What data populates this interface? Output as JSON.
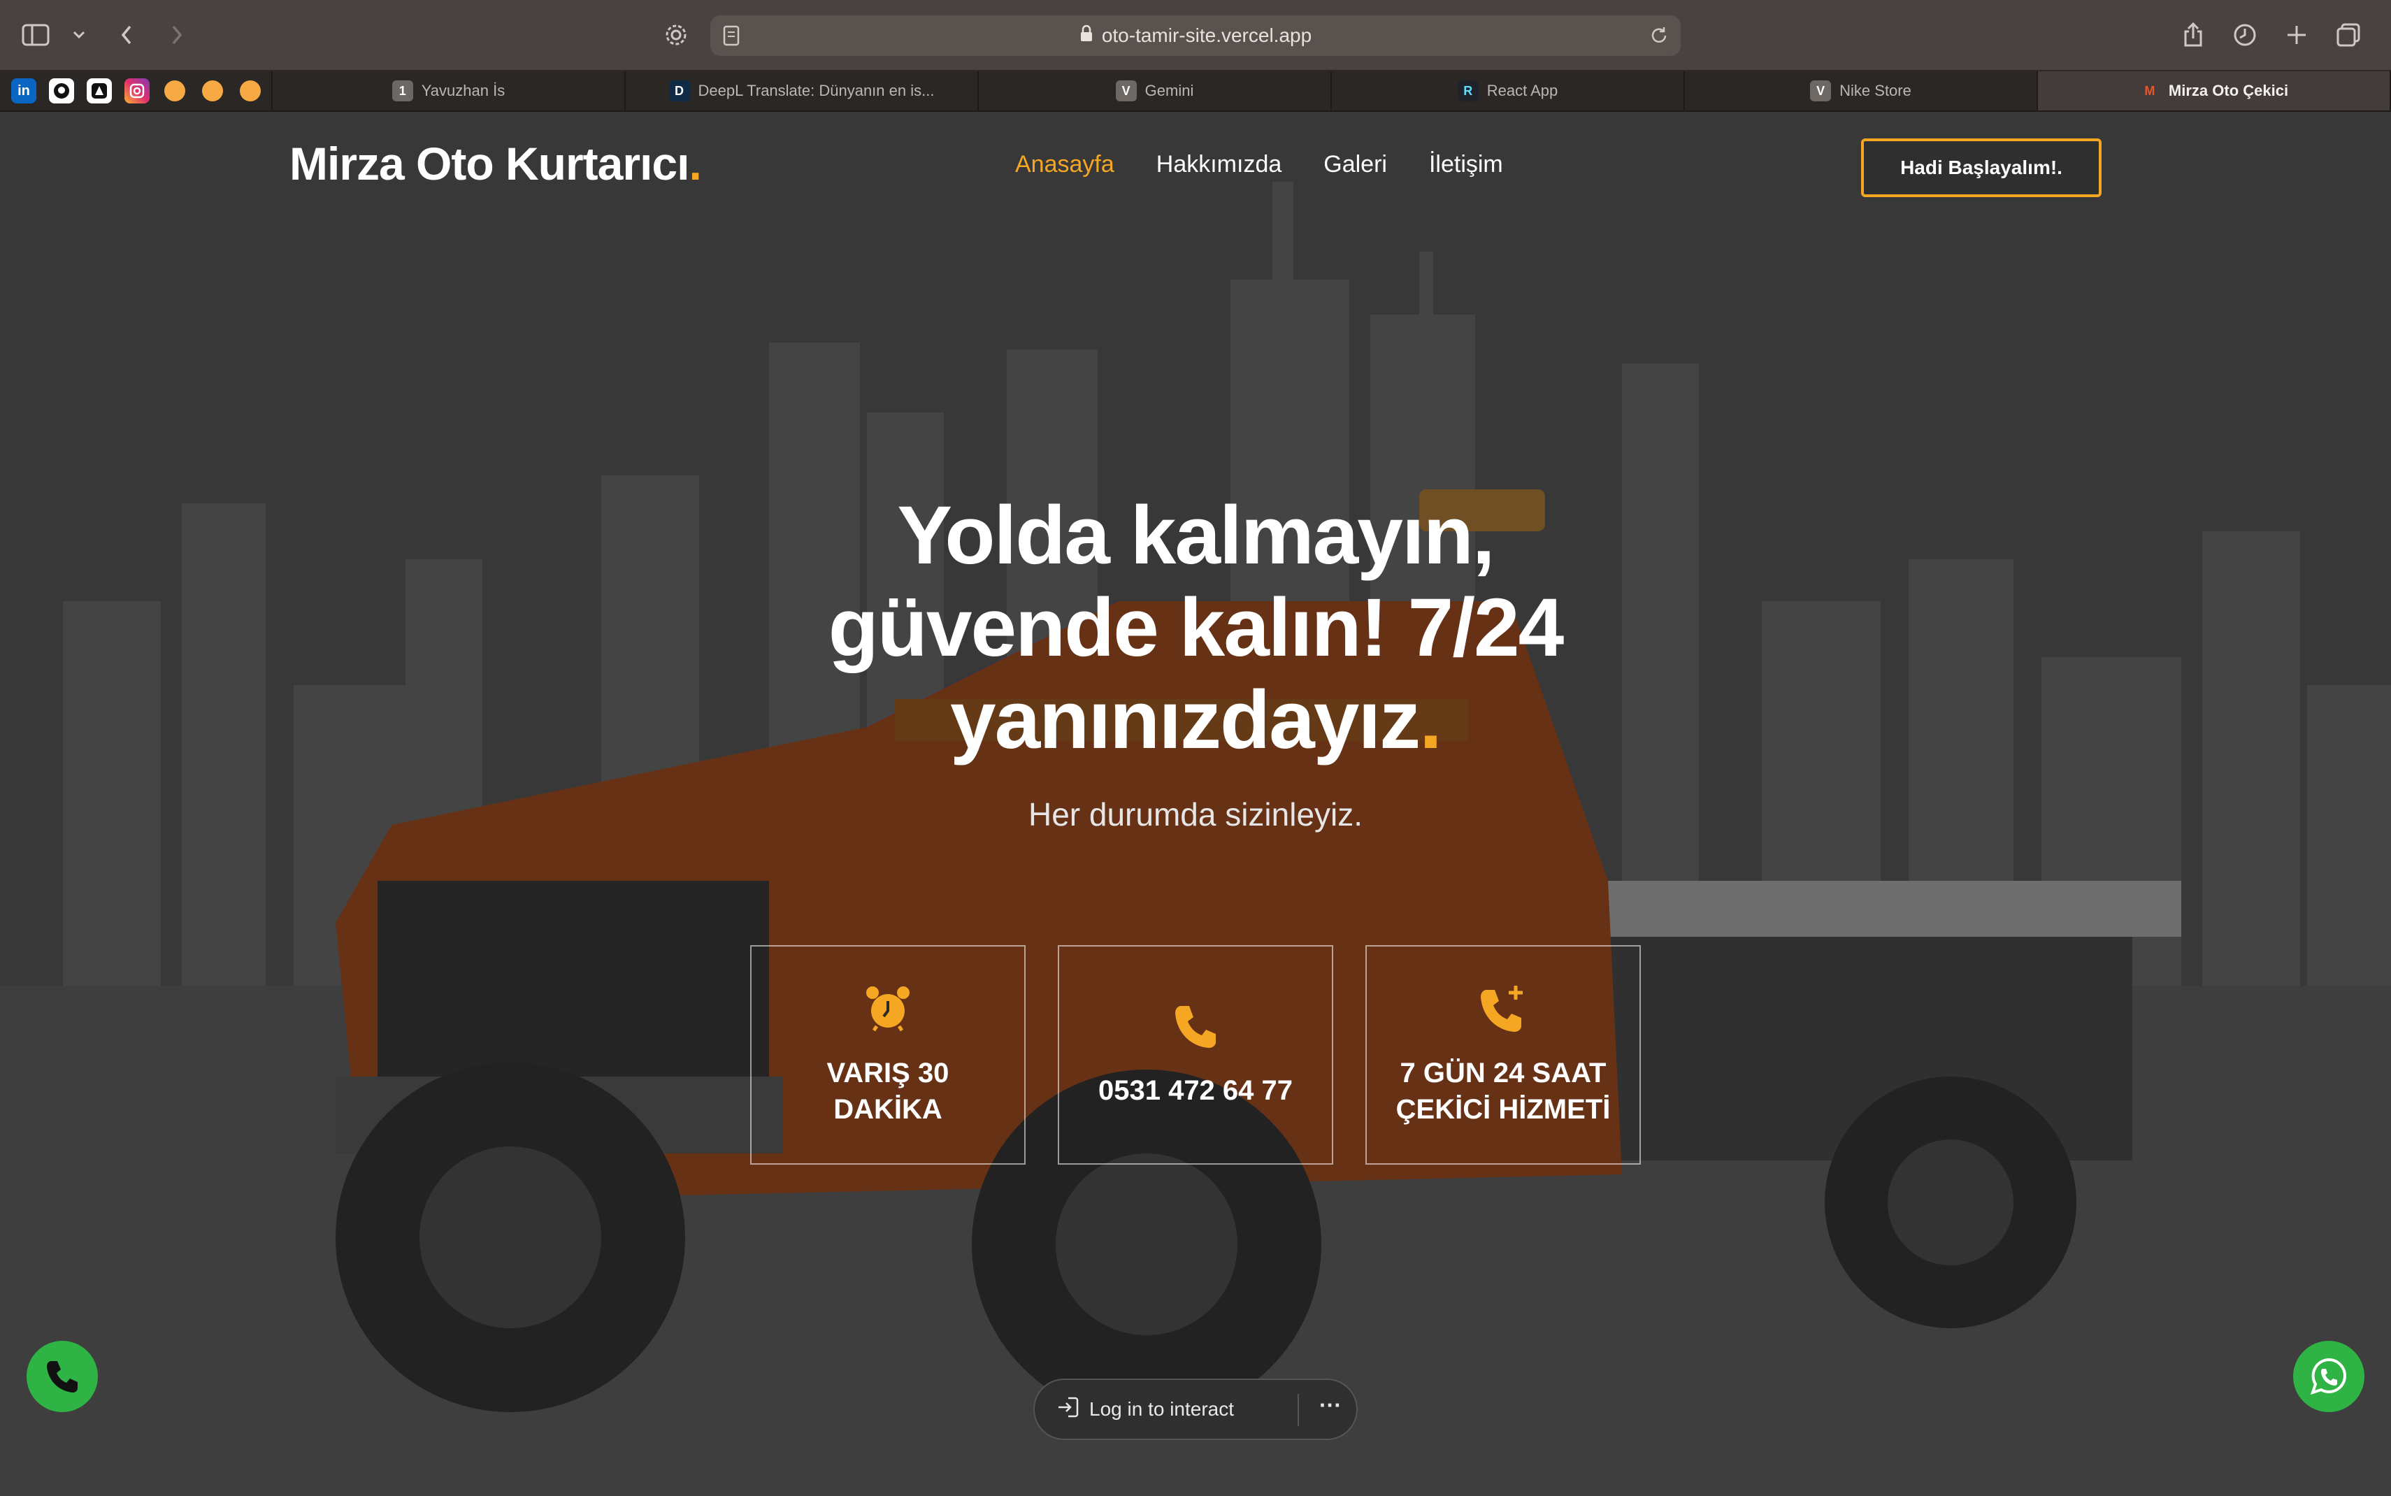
{
  "browser": {
    "url": "oto-tamir-site.vercel.app",
    "pinned_tabs": [
      "in",
      "github",
      "arc",
      "instagram",
      "orange-dot",
      "orange-dot",
      "orange-dot"
    ],
    "tabs": [
      {
        "label": "Yavuzhan İs",
        "icon": "1"
      },
      {
        "label": "DeepL Translate: Dünyanın en is...",
        "icon": "D"
      },
      {
        "label": "Gemini",
        "icon": "V"
      },
      {
        "label": "React App",
        "icon": "R"
      },
      {
        "label": "Nike Store",
        "icon": "V"
      },
      {
        "label": "Mirza Oto Çekici",
        "icon": "M"
      }
    ]
  },
  "site": {
    "logo": "Mirza Oto Kurtarıcı",
    "logo_dot": ".",
    "nav": [
      "Anasayfa",
      "Hakkımızda",
      "Galeri",
      "İletişim"
    ],
    "cta": "Hadi Başlayalım!.",
    "hero": {
      "title_line1": "Yolda kalmayın,",
      "title_line2": "güvende kalın! 7/24",
      "title_line3": "yanınızdayız",
      "title_dot": ".",
      "subtitle": "Her durumda sizinleyiz."
    },
    "cards": [
      {
        "icon": "alarm-clock-icon",
        "text": "VARIŞ 30 DAKİKA"
      },
      {
        "icon": "phone-icon",
        "text": "0531 472 64 77"
      },
      {
        "icon": "phone-plus-icon",
        "text": "7 GÜN 24 SAAT ÇEKİCİ HİZMETİ"
      }
    ]
  },
  "overlay": {
    "login_label": "Log in to interact",
    "more": "···"
  },
  "colors": {
    "accent": "#f5a623",
    "fab_green": "#2fb345"
  }
}
